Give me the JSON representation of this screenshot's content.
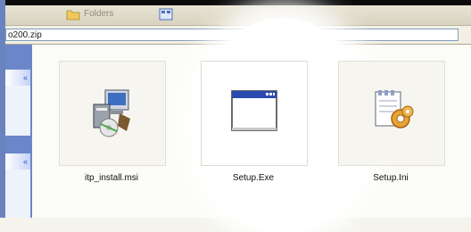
{
  "toolbar": {
    "folders_label": "Folders"
  },
  "address": {
    "value": "o200.zip"
  },
  "task_panes": [
    {
      "chevron": "«"
    },
    {
      "chevron": "«"
    }
  ],
  "files": [
    {
      "name": "itp_install.msi",
      "icon": "msi-installer-icon"
    },
    {
      "name": "Setup.Exe",
      "icon": "application-window-icon"
    },
    {
      "name": "Setup.Ini",
      "icon": "config-settings-icon"
    }
  ],
  "colors": {
    "highlight": "#ffffff",
    "taskpane": "#6b86c9",
    "window_titlebar": "#2a4bb0"
  }
}
